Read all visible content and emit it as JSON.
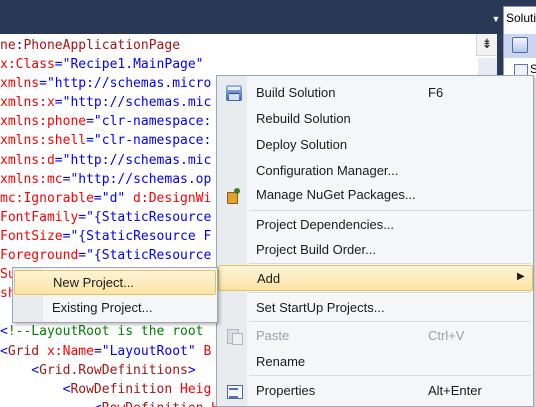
{
  "solution_panel": {
    "tab_label": "Solutio",
    "item_label": "S"
  },
  "editor": {
    "lines": [
      [
        [
          "elem",
          "ne"
        ],
        [
          "brk",
          ":"
        ],
        [
          "elem",
          "PhoneApplicationPage"
        ]
      ],
      [
        [
          "attr",
          "x:Class"
        ],
        [
          "brk",
          "="
        ],
        [
          "val",
          "\"Recipe1.MainPage\""
        ]
      ],
      [
        [
          "attr",
          "xmlns"
        ],
        [
          "brk",
          "="
        ],
        [
          "val",
          "\"http://schemas.micro"
        ]
      ],
      [
        [
          "attr",
          "xmlns:x"
        ],
        [
          "brk",
          "="
        ],
        [
          "val",
          "\"http://schemas.mic"
        ]
      ],
      [
        [
          "attr",
          "xmlns:phone"
        ],
        [
          "brk",
          "="
        ],
        [
          "val",
          "\"clr-namespace:"
        ]
      ],
      [
        [
          "attr",
          "xmlns:shell"
        ],
        [
          "brk",
          "="
        ],
        [
          "val",
          "\"clr-namespace:"
        ]
      ],
      [
        [
          "attr",
          "xmlns:d"
        ],
        [
          "brk",
          "="
        ],
        [
          "val",
          "\"http://schemas.mic"
        ]
      ],
      [
        [
          "attr",
          "xmlns:mc"
        ],
        [
          "brk",
          "="
        ],
        [
          "val",
          "\"http://schemas.op"
        ]
      ],
      [
        [
          "attr",
          "mc:Ignorable"
        ],
        [
          "brk",
          "="
        ],
        [
          "val",
          "\"d\""
        ],
        [
          "attr",
          " d:DesignWi"
        ]
      ],
      [
        [
          "attr",
          "FontFamily"
        ],
        [
          "brk",
          "="
        ],
        [
          "val",
          "\"{StaticResource"
        ]
      ],
      [
        [
          "attr",
          "FontSize"
        ],
        [
          "brk",
          "="
        ],
        [
          "val",
          "\"{StaticResource F"
        ]
      ],
      [
        [
          "attr",
          "Foreground"
        ],
        [
          "brk",
          "="
        ],
        [
          "val",
          "\"{StaticResource"
        ]
      ],
      [
        [
          "attr",
          "Su"
        ]
      ],
      [
        [
          "attr",
          "sh"
        ]
      ],
      [
        [
          "brk",
          ""
        ]
      ],
      [
        [
          "brk",
          "<"
        ],
        [
          "cmt",
          "!--LayoutRoot is the root"
        ]
      ],
      [
        [
          "brk",
          "<"
        ],
        [
          "elem",
          "Grid"
        ],
        [
          "attr",
          " x:Name"
        ],
        [
          "brk",
          "="
        ],
        [
          "val",
          "\"LayoutRoot\""
        ],
        [
          "attr",
          " B"
        ]
      ],
      [
        [
          "brk",
          "    <"
        ],
        [
          "elem",
          "Grid.RowDefinitions"
        ],
        [
          "brk",
          ">"
        ]
      ],
      [
        [
          "brk",
          "        <"
        ],
        [
          "elem",
          "RowDefinition"
        ],
        [
          "attr",
          " Heig"
        ]
      ],
      [
        [
          "brk",
          "            <"
        ],
        [
          "elem",
          "RowDefinition"
        ],
        [
          "attr",
          " Heig"
        ]
      ]
    ]
  },
  "context_menu": {
    "items": [
      {
        "label": "Build Solution",
        "shortcut": "F6",
        "icon": "build-solution-icon"
      },
      {
        "label": "Rebuild Solution",
        "shortcut": ""
      },
      {
        "label": "Deploy Solution",
        "shortcut": ""
      },
      {
        "label": "Configuration Manager...",
        "shortcut": ""
      },
      {
        "label": "Manage NuGet Packages...",
        "shortcut": "",
        "icon": "nuget-icon"
      },
      {
        "label": "Project Dependencies...",
        "shortcut": ""
      },
      {
        "label": "Project Build Order...",
        "shortcut": ""
      },
      {
        "label": "Add",
        "shortcut": "",
        "submenu": true
      },
      {
        "label": "Set StartUp Projects...",
        "shortcut": ""
      },
      {
        "label": "Paste",
        "shortcut": "Ctrl+V",
        "icon": "paste-icon",
        "disabled": true
      },
      {
        "label": "Rename",
        "shortcut": ""
      },
      {
        "label": "Properties",
        "shortcut": "Alt+Enter",
        "icon": "properties-icon"
      }
    ]
  },
  "add_submenu": {
    "items": [
      {
        "label": "New Project..."
      },
      {
        "label": "Existing Project..."
      }
    ]
  },
  "colors": {
    "highlight_top": "#fdf4d8",
    "highlight_bottom": "#fbe3a2",
    "xml_element": "#a31515",
    "xml_attribute": "#ff0000",
    "xml_value": "#0000ff",
    "xml_comment": "#008000",
    "chrome_dark": "#293955"
  }
}
